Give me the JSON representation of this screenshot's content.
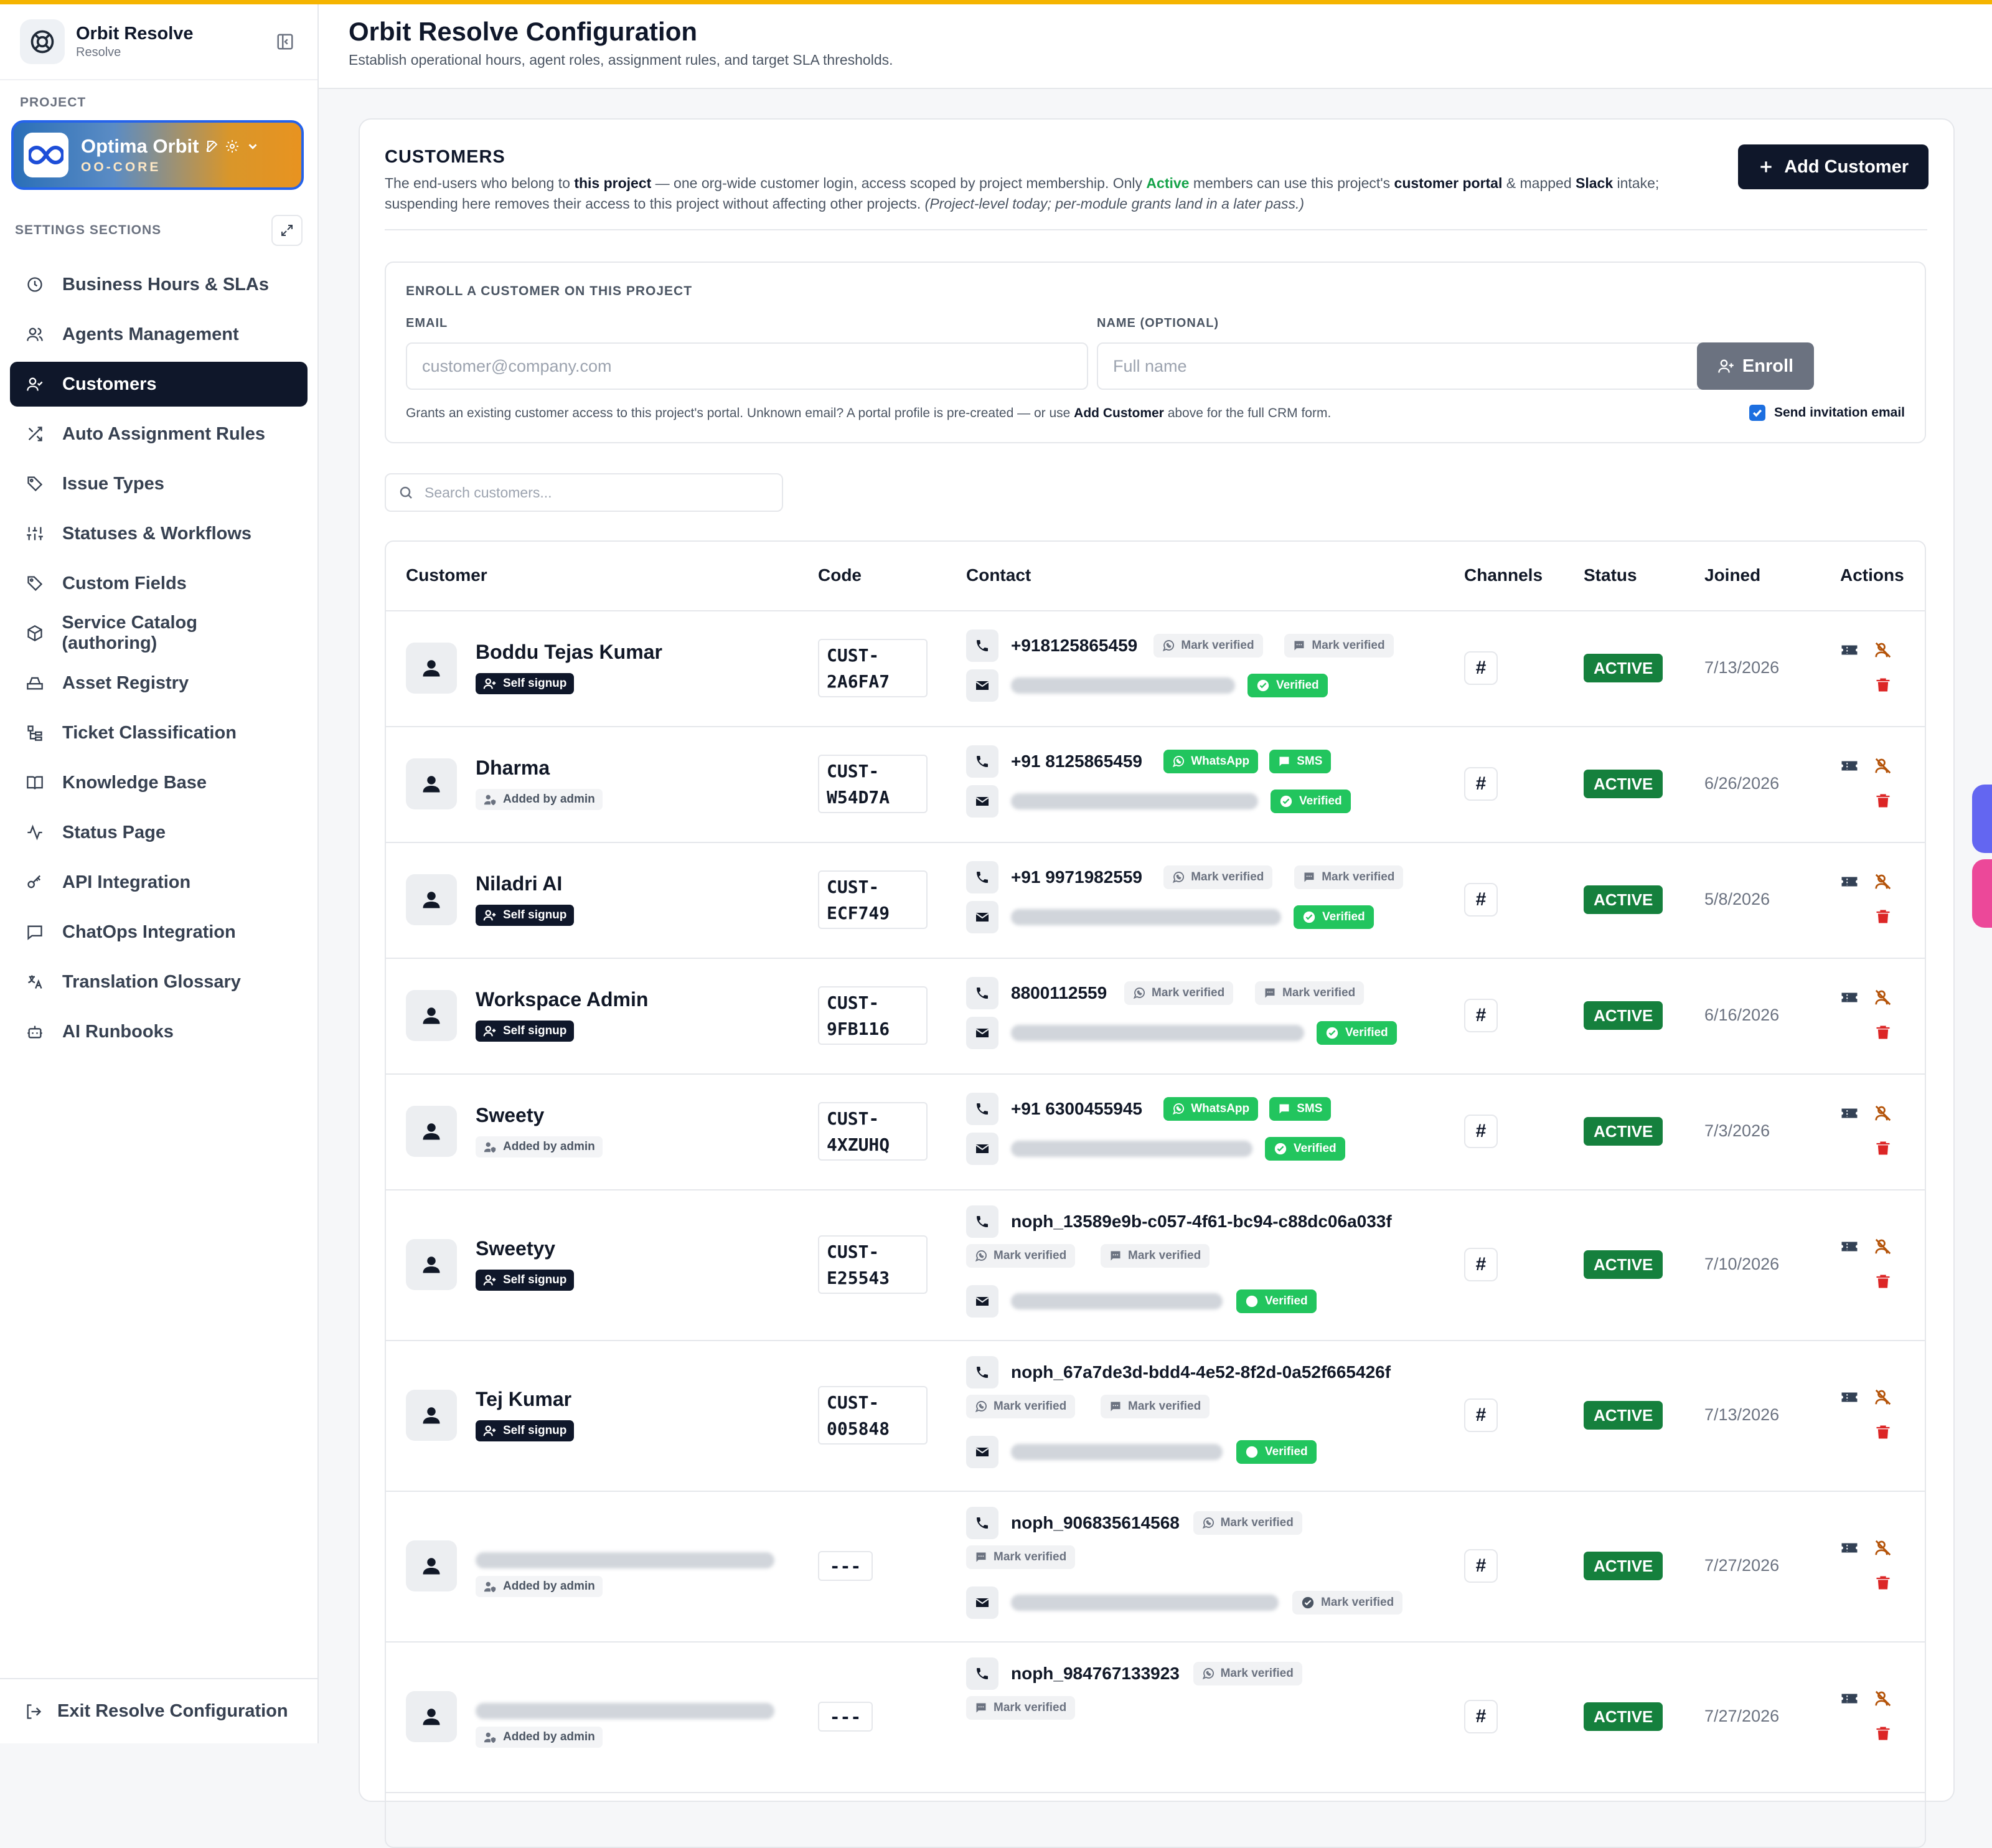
{
  "app": {
    "name": "Orbit Resolve",
    "subtitle": "Resolve"
  },
  "sidebar": {
    "project_label": "PROJECT",
    "project": {
      "name": "Optima Orbit",
      "code": "OO-CORE"
    },
    "settings_label": "SETTINGS SECTIONS",
    "items": [
      {
        "label": "Business Hours & SLAs",
        "icon": "clock-icon"
      },
      {
        "label": "Agents Management",
        "icon": "users-icon"
      },
      {
        "label": "Customers",
        "icon": "user-check-icon",
        "active": true
      },
      {
        "label": "Auto Assignment Rules",
        "icon": "shuffle-icon"
      },
      {
        "label": "Issue Types",
        "icon": "tag-icon"
      },
      {
        "label": "Statuses & Workflows",
        "icon": "sliders-icon"
      },
      {
        "label": "Custom Fields",
        "icon": "tag-icon"
      },
      {
        "label": "Service Catalog (authoring)",
        "icon": "package-icon"
      },
      {
        "label": "Asset Registry",
        "icon": "hard-drive-icon"
      },
      {
        "label": "Ticket Classification",
        "icon": "tree-icon"
      },
      {
        "label": "Knowledge Base",
        "icon": "book-icon"
      },
      {
        "label": "Status Page",
        "icon": "activity-icon"
      },
      {
        "label": "API Integration",
        "icon": "key-icon"
      },
      {
        "label": "ChatOps Integration",
        "icon": "message-icon"
      },
      {
        "label": "Translation Glossary",
        "icon": "translate-icon"
      },
      {
        "label": "AI Runbooks",
        "icon": "bot-icon"
      }
    ],
    "exit_label": "Exit Resolve Configuration"
  },
  "header": {
    "title": "Orbit Resolve Configuration",
    "subtitle": "Establish operational hours, agent roles, assignment rules, and target SLA thresholds."
  },
  "customers": {
    "title": "CUSTOMERS",
    "desc": {
      "p1": "The end-users who belong to ",
      "b1": "this project",
      "p2": " — one org-wide customer login, access scoped by project membership. Only ",
      "active": "Active",
      "p3": " members can use this project's ",
      "b2": "customer portal",
      "p4": " & mapped ",
      "b3": "Slack",
      "p5": " intake; suspending here removes their access to this project without affecting other projects. ",
      "note": "(Project-level today; per-module grants land in a later pass.)"
    },
    "add_button": "Add Customer",
    "enroll": {
      "title": "ENROLL A CUSTOMER ON THIS PROJECT",
      "email_label": "EMAIL",
      "email_placeholder": "customer@company.com",
      "name_label": "NAME (OPTIONAL)",
      "name_placeholder": "Full name",
      "button": "Enroll",
      "hint_p1": "Grants an existing customer access to this project's portal. Unknown email? A portal profile is pre-created — or use ",
      "hint_b": "Add Customer",
      "hint_p2": " above for the full CRM form.",
      "invite_label": "Send invitation email",
      "invite_checked": true
    },
    "search_placeholder": "Search customers...",
    "columns": [
      "Customer",
      "Code",
      "Contact",
      "Channels",
      "Status",
      "Joined",
      "Actions"
    ],
    "rows": [
      {
        "name": "Boddu Tejas Kumar",
        "badge": "Self signup",
        "code1": "CUST-",
        "code2": "2A6FA7",
        "phone": "+918125865459",
        "wa": "Mark verified",
        "sms": "Mark verified",
        "email_status": "Verified",
        "status": "ACTIVE",
        "joined": "7/13/2026"
      },
      {
        "name": "Dharma",
        "badge": "Added by admin",
        "code1": "CUST-",
        "code2": "W54D7A",
        "phone": "+91 8125865459",
        "wa": "WhatsApp",
        "sms": "SMS",
        "email_status": "Verified",
        "status": "ACTIVE",
        "joined": "6/26/2026"
      },
      {
        "name": "Niladri AI",
        "badge": "Self signup",
        "code1": "CUST-",
        "code2": "ECF749",
        "phone": "+91 9971982559",
        "wa": "Mark verified",
        "sms": "Mark verified",
        "email_status": "Verified",
        "status": "ACTIVE",
        "joined": "5/8/2026"
      },
      {
        "name": "Workspace Admin",
        "badge": "Self signup",
        "code1": "CUST-",
        "code2": "9FB116",
        "phone": "8800112559",
        "wa": "Mark verified",
        "sms": "Mark verified",
        "email_status": "Verified",
        "status": "ACTIVE",
        "joined": "6/16/2026"
      },
      {
        "name": "Sweety",
        "badge": "Added by admin",
        "code1": "CUST-",
        "code2": "4XZUHQ",
        "phone": "+91 6300455945",
        "wa": "WhatsApp",
        "sms": "SMS",
        "email_status": "Verified",
        "status": "ACTIVE",
        "joined": "7/3/2026"
      },
      {
        "name": "Sweetyy",
        "badge": "Self signup",
        "code1": "CUST-",
        "code2": "E25543",
        "phone": "noph_13589e9b-c057-4f61-bc94-c88dc06a033f",
        "wa": "Mark verified",
        "sms": "Mark verified",
        "email_status": "Verified",
        "status": "ACTIVE",
        "joined": "7/10/2026"
      },
      {
        "name": "Tej Kumar",
        "badge": "Self signup",
        "code1": "CUST-",
        "code2": "005848",
        "phone": "noph_67a7de3d-bdd4-4e52-8f2d-0a52f665426f",
        "wa": "Mark verified",
        "sms": "Mark verified",
        "email_status": "Verified",
        "status": "ACTIVE",
        "joined": "7/13/2026"
      },
      {
        "name": "",
        "badge": "Added by admin",
        "code": "---",
        "phone": "noph_906835614568",
        "wa": "Mark verified",
        "sms": "Mark verified",
        "email_status": "Mark verified",
        "status": "ACTIVE",
        "joined": "7/27/2026"
      },
      {
        "name": "",
        "badge": "Added by admin",
        "code": "---",
        "phone": "noph_984767133923",
        "wa": "Mark verified",
        "sms": "Mark verified",
        "status": "ACTIVE",
        "joined": "7/27/2026"
      }
    ]
  },
  "colors": {
    "accent_bar": "#f5b400",
    "primary": "#0f172a",
    "active_green": "#15803d",
    "verified_green": "#22c55e",
    "delete_red": "#dc2626"
  }
}
